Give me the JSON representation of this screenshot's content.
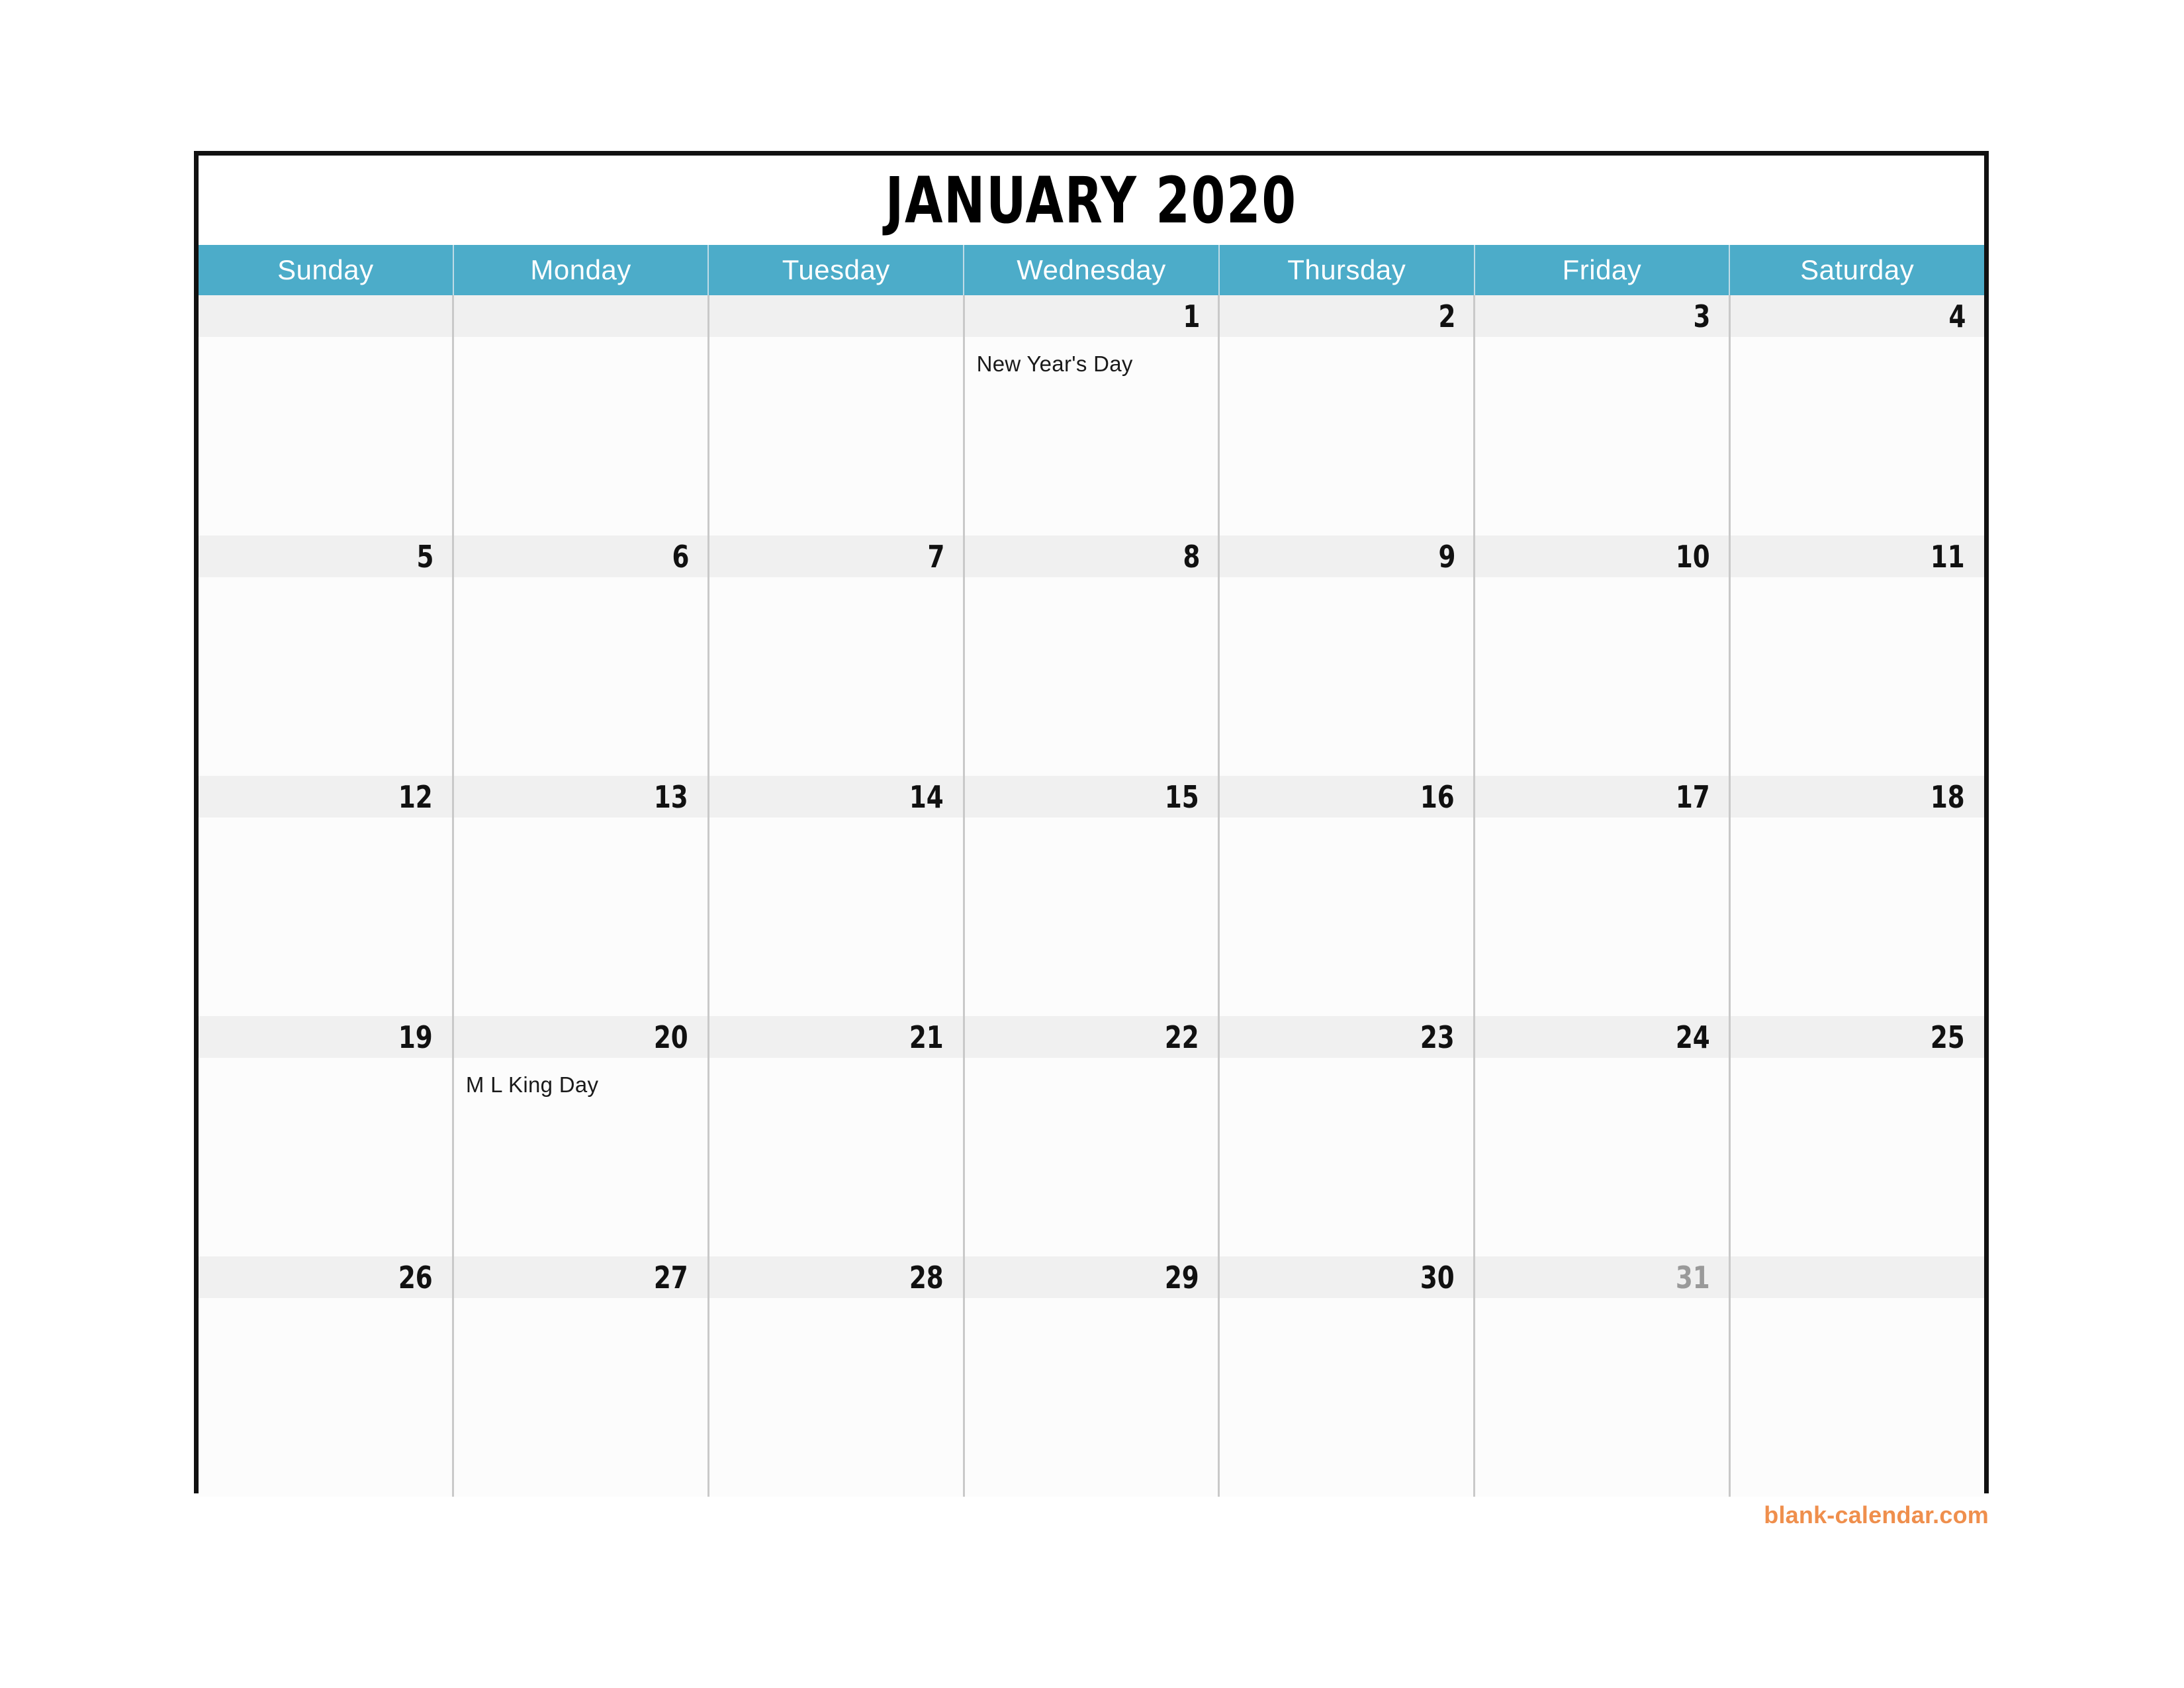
{
  "title": "JANUARY 2020",
  "weekdays": [
    "Sunday",
    "Monday",
    "Tuesday",
    "Wednesday",
    "Thursday",
    "Friday",
    "Saturday"
  ],
  "colors": {
    "header_background": "#4cacc9",
    "header_text": "#ffffff",
    "date_strip_background": "#f0f0f0",
    "cell_background": "#fcfcfc",
    "grid_line": "#c9c9c9",
    "outer_border": "#111111",
    "date_text": "#111111",
    "date_text_muted": "#9a9a9a",
    "watermark": "#ef8f4d"
  },
  "weeks": [
    [
      {
        "date": "",
        "event": "",
        "muted": false
      },
      {
        "date": "",
        "event": "",
        "muted": false
      },
      {
        "date": "",
        "event": "",
        "muted": false
      },
      {
        "date": "1",
        "event": "New Year's Day",
        "muted": false
      },
      {
        "date": "2",
        "event": "",
        "muted": false
      },
      {
        "date": "3",
        "event": "",
        "muted": false
      },
      {
        "date": "4",
        "event": "",
        "muted": false
      }
    ],
    [
      {
        "date": "5",
        "event": "",
        "muted": false
      },
      {
        "date": "6",
        "event": "",
        "muted": false
      },
      {
        "date": "7",
        "event": "",
        "muted": false
      },
      {
        "date": "8",
        "event": "",
        "muted": false
      },
      {
        "date": "9",
        "event": "",
        "muted": false
      },
      {
        "date": "10",
        "event": "",
        "muted": false
      },
      {
        "date": "11",
        "event": "",
        "muted": false
      }
    ],
    [
      {
        "date": "12",
        "event": "",
        "muted": false
      },
      {
        "date": "13",
        "event": "",
        "muted": false
      },
      {
        "date": "14",
        "event": "",
        "muted": false
      },
      {
        "date": "15",
        "event": "",
        "muted": false
      },
      {
        "date": "16",
        "event": "",
        "muted": false
      },
      {
        "date": "17",
        "event": "",
        "muted": false
      },
      {
        "date": "18",
        "event": "",
        "muted": false
      }
    ],
    [
      {
        "date": "19",
        "event": "",
        "muted": false
      },
      {
        "date": "20",
        "event": "M L King Day",
        "muted": false
      },
      {
        "date": "21",
        "event": "",
        "muted": false
      },
      {
        "date": "22",
        "event": "",
        "muted": false
      },
      {
        "date": "23",
        "event": "",
        "muted": false
      },
      {
        "date": "24",
        "event": "",
        "muted": false
      },
      {
        "date": "25",
        "event": "",
        "muted": false
      }
    ],
    [
      {
        "date": "26",
        "event": "",
        "muted": false
      },
      {
        "date": "27",
        "event": "",
        "muted": false
      },
      {
        "date": "28",
        "event": "",
        "muted": false
      },
      {
        "date": "29",
        "event": "",
        "muted": false
      },
      {
        "date": "30",
        "event": "",
        "muted": false
      },
      {
        "date": "31",
        "event": "",
        "muted": true
      },
      {
        "date": "",
        "event": "",
        "muted": false
      }
    ]
  ],
  "watermark": "blank-calendar.com"
}
